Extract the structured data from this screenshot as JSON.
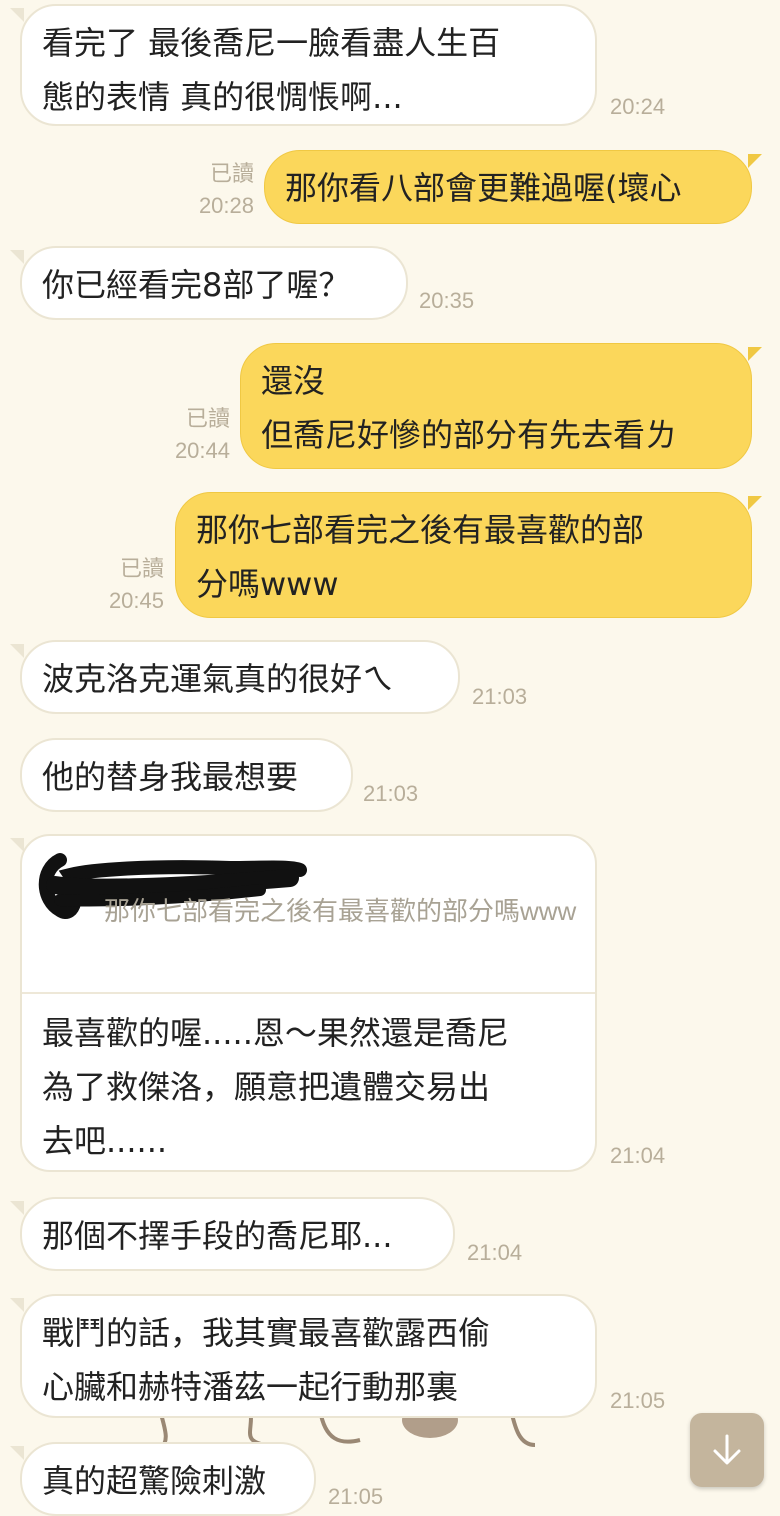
{
  "messages": [
    {
      "dir": "in",
      "text": "看完了 最後喬尼一臉看盡人生百\n態的表情 真的很惆悵啊...",
      "time": "20:24"
    },
    {
      "dir": "out",
      "text": "那你看八部會更難過喔(壞心",
      "time": "20:28",
      "read": "已讀"
    },
    {
      "dir": "in",
      "text": "你已經看完8部了喔？",
      "time": "20:35"
    },
    {
      "dir": "out",
      "text": "還沒\n但喬尼好慘的部分有先去看ㄌ",
      "time": "20:44",
      "read": "已讀"
    },
    {
      "dir": "out",
      "text": "那你七部看完之後有最喜歡的部\n分嗎www",
      "time": "20:45",
      "read": "已讀"
    },
    {
      "dir": "in",
      "text": "波克洛克運氣真的很好ㄟ",
      "time": "21:03"
    },
    {
      "dir": "in",
      "text": "他的替身我最想要",
      "time": "21:03"
    },
    {
      "dir": "in",
      "type": "reply",
      "quote": "那你七部看完之後有最喜歡的部分嗎www",
      "text": "最喜歡的喔.....恩～果然還是喬尼\n為了救傑洛，願意把遺體交易出\n去吧......",
      "time": "21:04"
    },
    {
      "dir": "in",
      "text": "那個不擇手段的喬尼耶...",
      "time": "21:04"
    },
    {
      "dir": "in",
      "text": "戰鬥的話，我其實最喜歡露西偷\n心臟和赫特潘茲一起行動那裏",
      "time": "21:05"
    },
    {
      "dir": "in",
      "text": "真的超驚險刺激",
      "time": "21:05"
    }
  ],
  "icons": {
    "scroll_down": "arrow-down-icon"
  },
  "colors": {
    "background": "#fcf8ec",
    "outgoing_bubble": "#fbd75b",
    "incoming_bubble": "#ffffff",
    "scroll_button": "#c4b59d"
  }
}
